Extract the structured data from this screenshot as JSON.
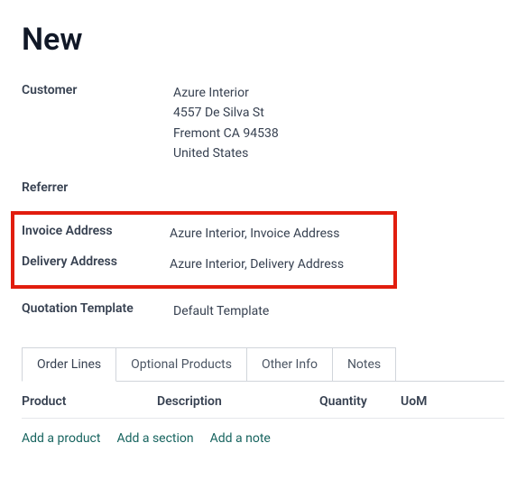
{
  "title": "New",
  "fields": {
    "customer": {
      "label": "Customer",
      "name": "Azure Interior",
      "street": "4557 De Silva St",
      "city_line": "Fremont CA 94538",
      "country": "United States"
    },
    "referrer": {
      "label": "Referrer",
      "value": ""
    },
    "invoice_address": {
      "label": "Invoice Address",
      "value": "Azure Interior, Invoice Address"
    },
    "delivery_address": {
      "label": "Delivery Address",
      "value": "Azure Interior, Delivery Address"
    },
    "quotation_template": {
      "label": "Quotation Template",
      "value": "Default Template"
    }
  },
  "tabs": {
    "order_lines": "Order Lines",
    "optional_products": "Optional Products",
    "other_info": "Other Info",
    "notes": "Notes"
  },
  "columns": {
    "product": "Product",
    "description": "Description",
    "quantity": "Quantity",
    "uom": "UoM"
  },
  "actions": {
    "add_product": "Add a product",
    "add_section": "Add a section",
    "add_note": "Add a note"
  }
}
